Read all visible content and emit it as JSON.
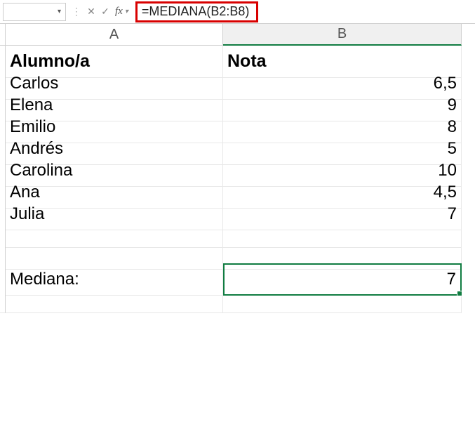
{
  "formula_bar": {
    "name_box_value": "",
    "cancel_glyph": "✕",
    "confirm_glyph": "✓",
    "fx_label": "fx",
    "formula": "=MEDIANA(B2:B8)"
  },
  "columns": [
    "A",
    "B"
  ],
  "headers": {
    "col_a": "Alumno/a",
    "col_b": "Nota"
  },
  "rows": [
    {
      "name": "Carlos",
      "value": "6,5"
    },
    {
      "name": "Elena",
      "value": "9"
    },
    {
      "name": "Emilio",
      "value": "8"
    },
    {
      "name": "Andrés",
      "value": "5"
    },
    {
      "name": "Carolina",
      "value": "10"
    },
    {
      "name": "Ana",
      "value": "4,5"
    },
    {
      "name": "Julia",
      "value": "7"
    }
  ],
  "summary": {
    "label": "Mediana:",
    "value": "7"
  }
}
